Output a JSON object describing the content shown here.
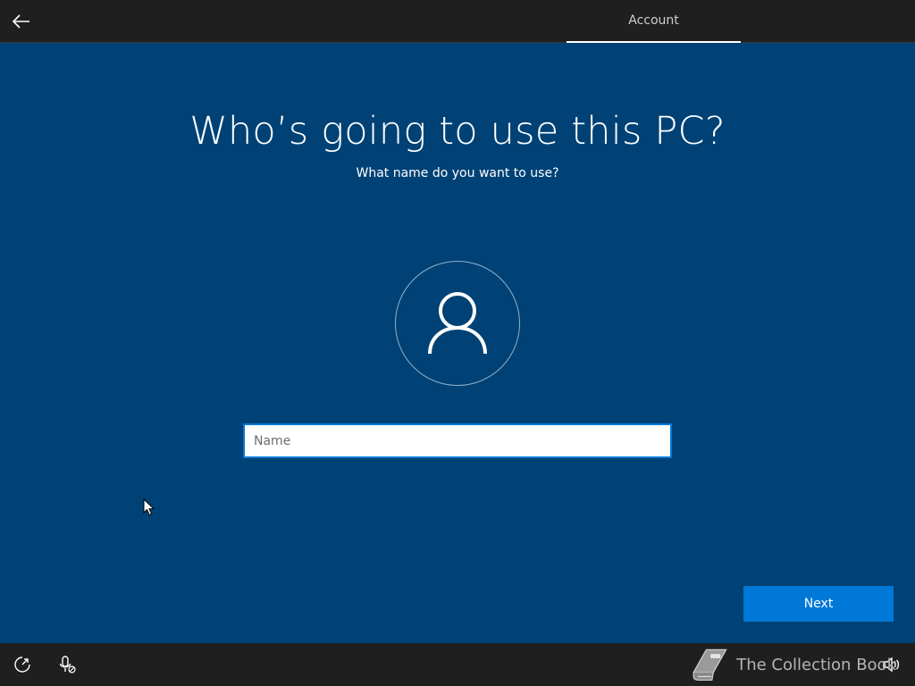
{
  "header": {
    "back_icon": "back-arrow-icon",
    "tab_label": "Account"
  },
  "main": {
    "title": "Who’s going to use this PC?",
    "subtitle": "What name do you want to use?",
    "avatar_icon": "user-icon",
    "name_placeholder": "Name",
    "name_value": ""
  },
  "footer": {
    "next_label": "Next",
    "icons": [
      "ease-of-access-icon",
      "microphone-icon",
      "volume-icon"
    ],
    "watermark_text": "The Collection Book",
    "watermark_icon": "book-icon"
  },
  "colors": {
    "background": "#004275",
    "bars": "#1f1f1f",
    "accent": "#0078d7"
  }
}
